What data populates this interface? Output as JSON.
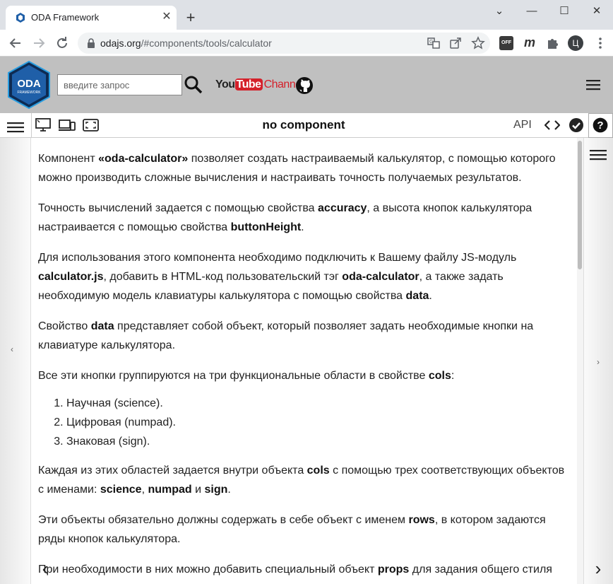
{
  "browser": {
    "tab_title": "ODA Framework",
    "tab_close": "✕",
    "new_tab": "+",
    "url_host": "odajs.org",
    "url_path": "/#components/tools/calculator",
    "window_minimize": "⌄",
    "window_restore": "—",
    "window_maximize": "☐",
    "window_close": "✕",
    "profile_letter": "Ц",
    "ext_off_label": "OFF",
    "ext_m_label": "m"
  },
  "site": {
    "search_placeholder": "введите запрос",
    "logo_text": "ODA",
    "logo_sub": "FRAMEWORK",
    "youtube_you": "You",
    "youtube_tube": "Tube",
    "youtube_channel": "Channel"
  },
  "component_bar": {
    "title": "no component",
    "api_label": "API"
  },
  "content": {
    "p1": {
      "a": "Компонент ",
      "b": "«oda-calculator»",
      "c": " позволяет создать настраиваемый калькулятор, с помощью которого можно производить сложные вычисления и настраивать точность получаемых результатов."
    },
    "p2": {
      "a": "Точность вычислений задается с помощью свойства ",
      "b": "accuracy",
      "c": ", а высота кнопок калькулятора настраивается с помощью свойства ",
      "d": "buttonHeight",
      "e": "."
    },
    "p3": {
      "a": "Для использования этого компонента необходимо подключить к Вашему файлу JS-модуль ",
      "b": "calculator.js",
      "c": ", добавить в HTML-код пользовательский тэг ",
      "d": "oda-calculator",
      "e": ", а также задать необходимую модель клавиатуры калькулятора с помощью свойства ",
      "f": "data",
      "g": "."
    },
    "p4": {
      "a": "Свойство ",
      "b": "data",
      "c": " представляет собой объект, который позволяет задать необходимые кнопки на клавиатуре калькулятора."
    },
    "p5": {
      "a": "Все эти кнопки группируются на три функциональные области в свойстве ",
      "b": "cols",
      "c": ":"
    },
    "list": [
      "Научная (science).",
      "Цифровая (numpad).",
      "Знаковая (sign)."
    ],
    "p6": {
      "a": "Каждая из этих областей задается внутри объекта ",
      "b": "cols",
      "c": " с помощью трех соответствующих объектов с именами: ",
      "d": "science",
      "e": ", ",
      "f": "numpad",
      "g": " и ",
      "h": "sign",
      "i": "."
    },
    "p7": {
      "a": "Эти объекты обязательно должны содержать в себе объект с именем ",
      "b": "rows",
      "c": ", в котором задаются ряды кнопок калькулятора."
    },
    "p8": {
      "a": "При необходимости в них можно добавить специальный объект ",
      "b": "props",
      "c": " для задания общего стиля"
    }
  },
  "nav": {
    "prev": "‹",
    "next": "›"
  },
  "colors": {
    "header_bg": "#c0c0c0",
    "tab_strip_bg": "#dee1e6",
    "logo_blue": "#1f5fa8"
  }
}
